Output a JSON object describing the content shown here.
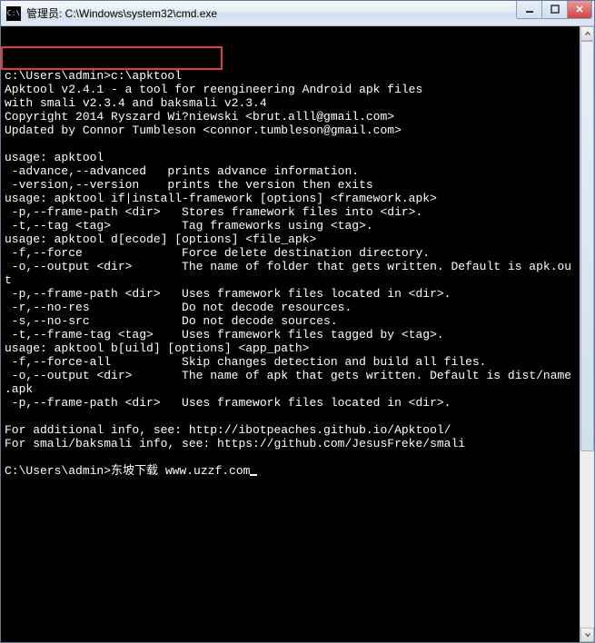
{
  "titlebar": {
    "icon_label": "C:\\",
    "title": "管理员: C:\\Windows\\system32\\cmd.exe"
  },
  "highlight": {
    "target_line": "cmd_line"
  },
  "terminal": {
    "blank_top": "",
    "cmd_line": "c:\\Users\\admin>c:\\apktool",
    "out1": "Apktool v2.4.1 - a tool for reengineering Android apk files",
    "out2": "with smali v2.3.4 and baksmali v2.3.4",
    "out3": "Copyright 2014 Ryszard Wi?niewski <brut.alll@gmail.com>",
    "out4": "Updated by Connor Tumbleson <connor.tumbleson@gmail.com>",
    "blank1": "",
    "out5": "usage: apktool",
    "out6": " -advance,--advanced   prints advance information.",
    "out7": " -version,--version    prints the version then exits",
    "out8": "usage: apktool if|install-framework [options] <framework.apk>",
    "out9": " -p,--frame-path <dir>   Stores framework files into <dir>.",
    "out10": " -t,--tag <tag>          Tag frameworks using <tag>.",
    "out11": "usage: apktool d[ecode] [options] <file_apk>",
    "out12": " -f,--force              Force delete destination directory.",
    "out13": " -o,--output <dir>       The name of folder that gets written. Default is apk.ou",
    "out13b": "t",
    "out14": " -p,--frame-path <dir>   Uses framework files located in <dir>.",
    "out15": " -r,--no-res             Do not decode resources.",
    "out16": " -s,--no-src             Do not decode sources.",
    "out17": " -t,--frame-tag <tag>    Uses framework files tagged by <tag>.",
    "out18": "usage: apktool b[uild] [options] <app_path>",
    "out19": " -f,--force-all          Skip changes detection and build all files.",
    "out20": " -o,--output <dir>       The name of apk that gets written. Default is dist/name",
    "out20b": ".apk",
    "out21": " -p,--frame-path <dir>   Uses framework files located in <dir>.",
    "blank2": "",
    "out22": "For additional info, see: http://ibotpeaches.github.io/Apktool/",
    "out23": "For smali/baksmali info, see: https://github.com/JesusFreke/smali",
    "blank3": "",
    "prompt2_prefix": "C:\\Users\\admin>",
    "prompt2_input": "东坡下载 www.uzzf.com"
  }
}
